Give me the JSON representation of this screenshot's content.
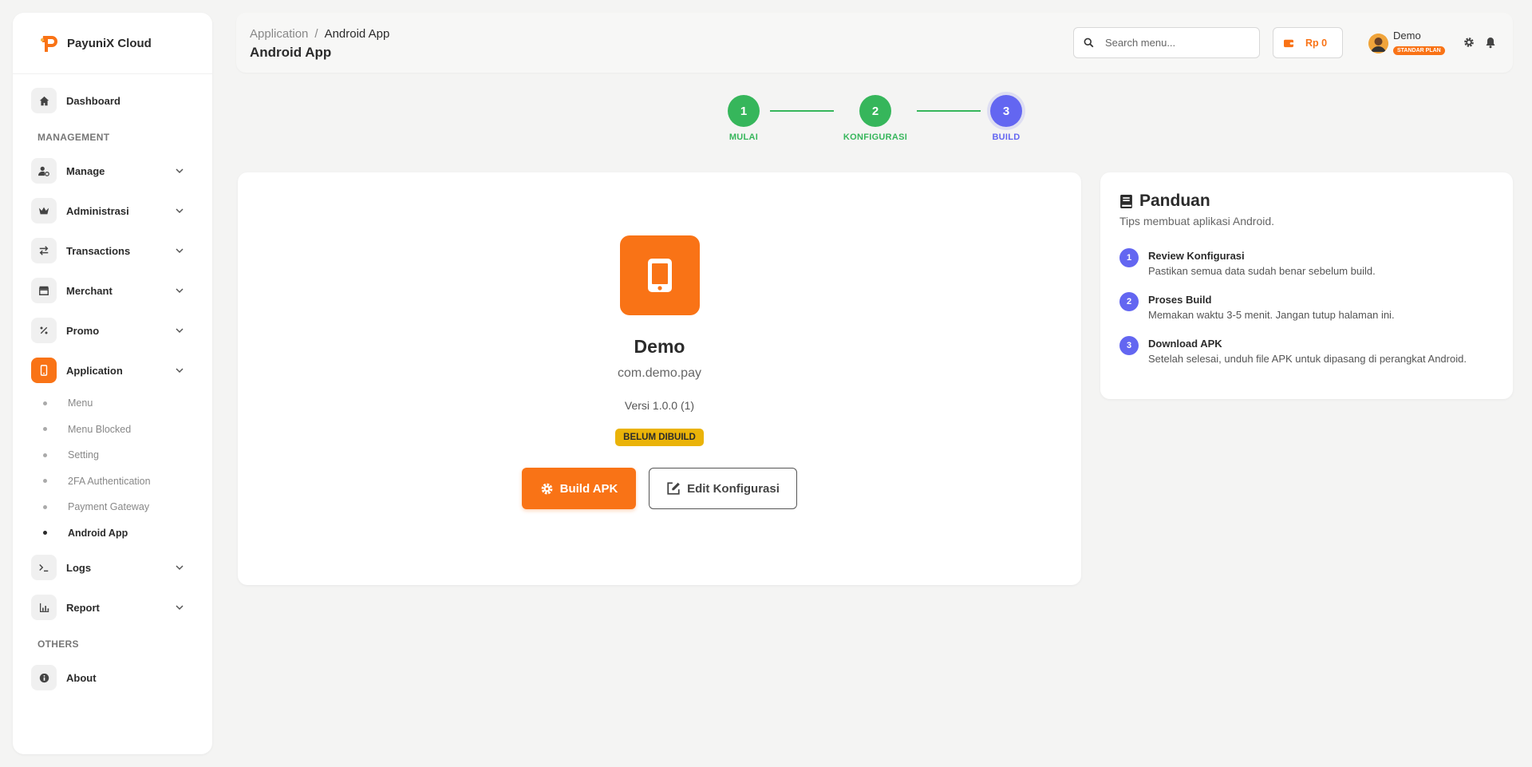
{
  "brand": {
    "name": "PayuniX Cloud"
  },
  "sidebar": {
    "dashboard": "Dashboard",
    "management_title": "MANAGEMENT",
    "items": [
      {
        "label": "Manage",
        "icon": "user-gear-icon"
      },
      {
        "label": "Administrasi",
        "icon": "crown-icon"
      },
      {
        "label": "Transactions",
        "icon": "arrows-exchange-icon"
      },
      {
        "label": "Merchant",
        "icon": "store-icon"
      },
      {
        "label": "Promo",
        "icon": "percent-icon"
      },
      {
        "label": "Application",
        "icon": "mobile-icon",
        "active": true
      }
    ],
    "sub_items": [
      "Menu",
      "Menu Blocked",
      "Setting",
      "2FA Authentication",
      "Payment Gateway",
      "Android App"
    ],
    "active_sub": "Android App",
    "logs": "Logs",
    "report": "Report",
    "others_title": "OTHERS",
    "about": "About"
  },
  "header": {
    "breadcrumb": [
      "Application",
      "Android App"
    ],
    "separator": "/",
    "title": "Android App",
    "search_placeholder": "Search menu...",
    "balance": "Rp 0",
    "user_name": "Demo",
    "plan": "STANDAR PLAN"
  },
  "stepper": [
    {
      "num": "1",
      "label": "MULAI",
      "state": "done",
      "color": "#36b65b"
    },
    {
      "num": "2",
      "label": "KONFIGURASI",
      "state": "done",
      "color": "#36b65b"
    },
    {
      "num": "3",
      "label": "BUILD",
      "state": "current",
      "color": "#6366f1"
    }
  ],
  "app": {
    "name": "Demo",
    "package": "com.demo.pay",
    "version": "Versi 1.0.0 (1)",
    "status": "BELUM DIBUILD",
    "build_button": "Build APK",
    "edit_button": "Edit Konfigurasi"
  },
  "guide": {
    "title": "Panduan",
    "subtitle": "Tips membuat aplikasi Android.",
    "steps": [
      {
        "num": "1",
        "title": "Review Konfigurasi",
        "desc": "Pastikan semua data sudah benar sebelum build."
      },
      {
        "num": "2",
        "title": "Proses Build",
        "desc": "Memakan waktu 3-5 menit. Jangan tutup halaman ini."
      },
      {
        "num": "3",
        "title": "Download APK",
        "desc": "Setelah selesai, unduh file APK untuk dipasang di perangkat Android."
      }
    ]
  },
  "colors": {
    "accent": "#f97316",
    "success": "#36b65b",
    "indigo": "#6366f1",
    "warning": "#eab308"
  }
}
